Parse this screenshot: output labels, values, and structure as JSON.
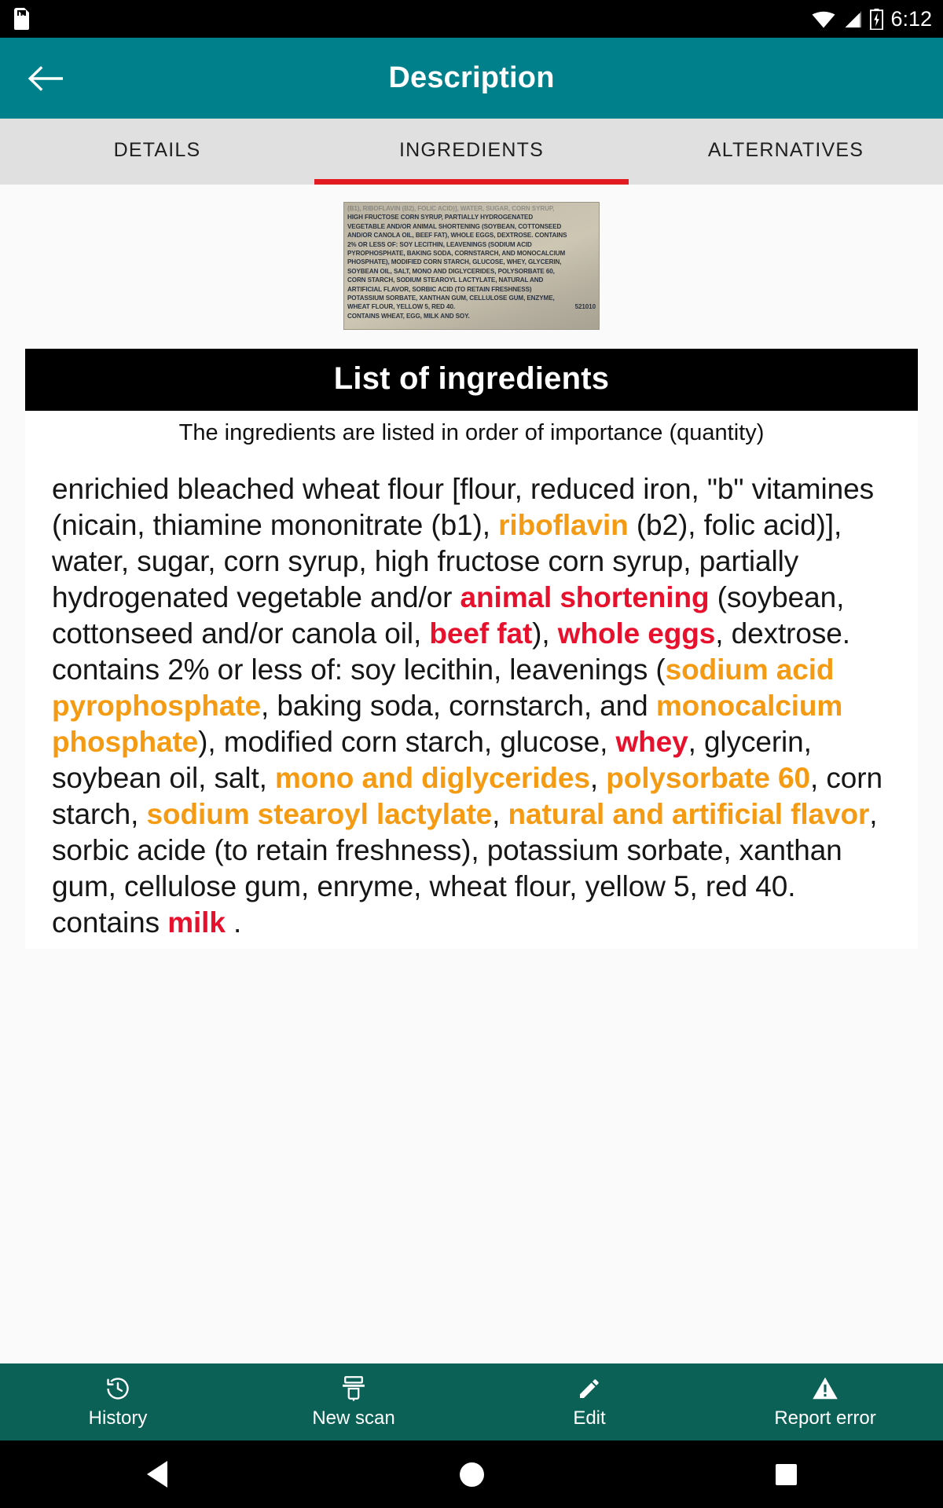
{
  "statusbar": {
    "time": "6:12",
    "icons": [
      "sd-card-icon",
      "wifi-icon",
      "cellular-signal-icon",
      "battery-charging-icon"
    ]
  },
  "appbar": {
    "title": "Description",
    "back_icon": "arrow-left-icon",
    "background_color": "#00808b"
  },
  "tabs": [
    {
      "label": "DETAILS",
      "active": false
    },
    {
      "label": "INGREDIENTS",
      "active": true
    },
    {
      "label": "ALTERNATIVES",
      "active": false
    }
  ],
  "tab_indicator_color": "#e21b23",
  "product_photo": {
    "alt": "ingredients-label-photo",
    "lines": [
      "(B1), RIBOFLAVIN (B2), FOLIC ACID)], WATER, SUGAR, CORN SYRUP,",
      "HIGH   FRUCTOSE   CORN   SYRUP,   PARTIALLY   HYDROGENATED",
      "VEGETABLE AND/OR ANIMAL SHORTENING (SOYBEAN, COTTONSEED",
      "AND/OR CANOLA OIL, BEEF FAT), WHOLE EGGS, DEXTROSE. CONTAINS",
      "2%  OR  LESS  OF:  SOY  LECITHIN,  LEAVENINGS  (SODIUM  ACID",
      "PYROPHOSPHATE, BAKING SODA, CORNSTARCH, AND MONOCALCIUM",
      "PHOSPHATE), MODIFIED CORN STARCH, GLUCOSE, WHEY, GLYCERIN,",
      "SOYBEAN OIL, SALT, MONO AND DIGLYCERIDES, POLYSORBATE 60,",
      "CORN STARCH, SODIUM STEAROYL LACTYLATE, NATURAL AND",
      "ARTIFICIAL   FLAVOR,   SORBIC   ACID   (TO   RETAIN   FRESHNESS)",
      "POTASSIUM SORBATE, XANTHAN GUM, CELLULOSE GUM, ENZYME,",
      "WHEAT FLOUR, YELLOW 5, RED 40.",
      "CONTAINS WHEAT, EGG, MILK AND SOY."
    ],
    "code": "521010"
  },
  "ingredients_section": {
    "banner_title": "List of ingredients",
    "subtitle": "The ingredients are listed in order of importance (quantity)",
    "highlight_colors": {
      "orange": "#f59b13",
      "red": "#e8112d"
    },
    "segments": [
      {
        "text": "enrichied bleached wheat flour [flour, reduced iron, \"b\" vitamines (nicain, thiamine mononitrate (b1), ",
        "style": "normal"
      },
      {
        "text": "riboflavin",
        "style": "orange"
      },
      {
        "text": " (b2), folic acid)], water, sugar, corn syrup, high fructose corn syrup, partially hydrogenated vegetable and/or ",
        "style": "normal"
      },
      {
        "text": "animal shortening",
        "style": "red"
      },
      {
        "text": " (soybean, cottonseed and/or canola oil, ",
        "style": "normal"
      },
      {
        "text": "beef fat",
        "style": "red"
      },
      {
        "text": "), ",
        "style": "normal"
      },
      {
        "text": "whole eggs",
        "style": "red"
      },
      {
        "text": ", dextrose. contains 2% or less of: soy lecithin, leavenings (",
        "style": "normal"
      },
      {
        "text": "sodium acid pyrophosphate",
        "style": "orange"
      },
      {
        "text": ", baking soda, cornstarch, and ",
        "style": "normal"
      },
      {
        "text": "monocalcium phosphate",
        "style": "orange"
      },
      {
        "text": "), modified corn starch, glucose, ",
        "style": "normal"
      },
      {
        "text": "whey",
        "style": "red"
      },
      {
        "text": ", glycerin, soybean oil, salt, ",
        "style": "normal"
      },
      {
        "text": "mono and diglycerides",
        "style": "orange"
      },
      {
        "text": ", ",
        "style": "normal"
      },
      {
        "text": "polysorbate 60",
        "style": "orange"
      },
      {
        "text": ", corn starch, ",
        "style": "normal"
      },
      {
        "text": "sodium stearoyl lactylate",
        "style": "orange"
      },
      {
        "text": ", ",
        "style": "normal"
      },
      {
        "text": "natural and artificial flavor",
        "style": "orange"
      },
      {
        "text": ", sorbic acide (to retain freshness), potassium sorbate, xanthan gum, cellulose gum, enryme, wheat flour, yellow 5, red 40. contains ",
        "style": "normal"
      },
      {
        "text": "milk",
        "style": "red"
      },
      {
        "text": " .",
        "style": "normal"
      }
    ]
  },
  "bottom_nav": {
    "background_color": "#0c6157",
    "items": [
      {
        "label": "History",
        "icon": "history-clock-icon"
      },
      {
        "label": "New scan",
        "icon": "scanner-icon"
      },
      {
        "label": "Edit",
        "icon": "pencil-icon"
      },
      {
        "label": "Report error",
        "icon": "warning-triangle-icon"
      }
    ]
  },
  "system_nav": {
    "back": "triangle-back-icon",
    "home": "circle-home-icon",
    "recents": "square-recents-icon"
  }
}
